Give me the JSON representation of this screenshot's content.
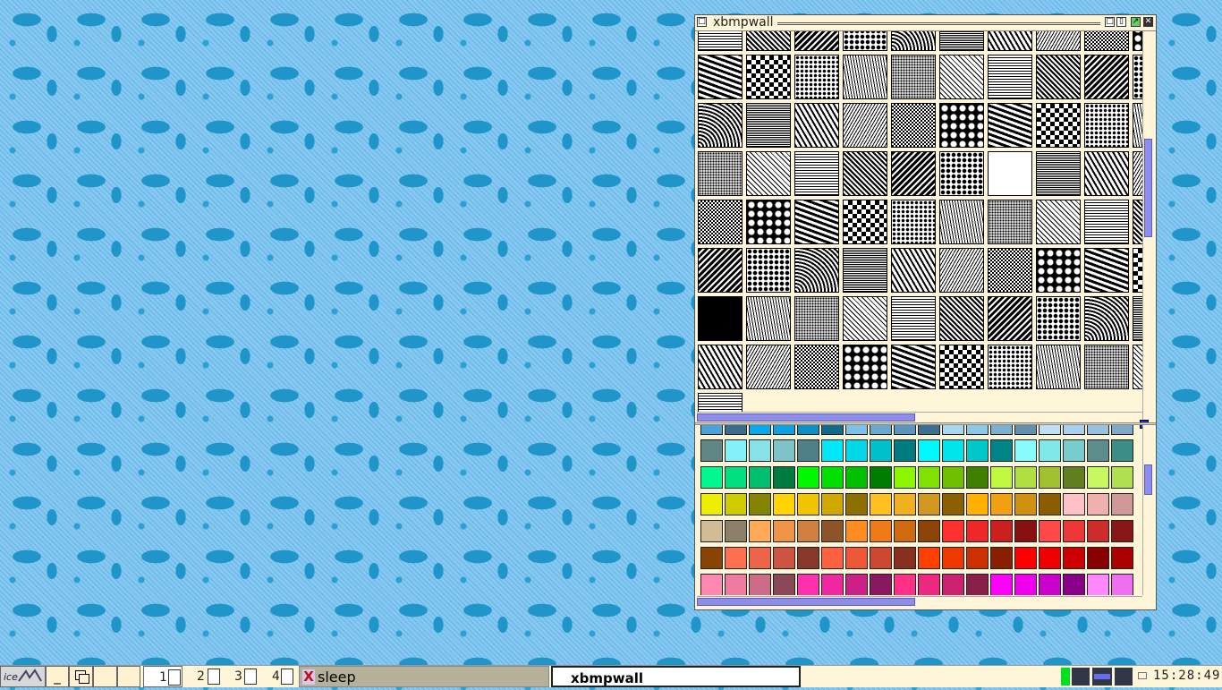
{
  "window": {
    "title": "xbmpwall",
    "title_icon": "window-menu-icon",
    "controls": [
      "minimize-icon",
      "maximize-icon",
      "shade-icon",
      "close-icon"
    ]
  },
  "patterns": [
    "check-small",
    "dark-diag",
    "swirl",
    "square-dots",
    "arc",
    "wave-text",
    "zigzag",
    "wave-dense",
    "checker-fine",
    "bumps",
    "waves",
    "weave",
    "floral",
    "wood-grain",
    "dots-fine",
    "diamond-lattice",
    "chevron-tile",
    "brick",
    "brick-dark",
    "diag-dots",
    "quilt",
    "crosshatch-fine",
    "grid-fine",
    "grid-med",
    "grid-dense",
    "grid-light",
    "diag-fine",
    "noise-dark",
    "dots-dense",
    "fine-mesh",
    "noise-mid",
    "noise-dense",
    "grid-dense2",
    "dark-mesh",
    "dark-mesh2",
    "dark-dots",
    "white",
    "sparse-dots",
    "dots-light",
    "dots-lighter",
    "dots-light2",
    "med-dots",
    "med-dots2",
    "lines-light",
    "lines-light2",
    "gray-dots",
    "gray-dots2",
    "gray-med",
    "gray-med2",
    "gray-dark",
    "gray-dark2",
    "gray-darker",
    "gray-darker2",
    "gray-darkest",
    "grid-light-sq",
    "hlines",
    "hlines-dense",
    "hlines-thick",
    "hlines-vdense",
    "grid-dark",
    "black",
    "black-grid",
    "hlines-dark",
    "diag-left",
    "diag-right-dense",
    "diag-right",
    "diag-right-thin",
    "diag-thick",
    "diag-thick2",
    "diag-thick3",
    "crosshatch",
    "diamond-dark",
    "vlines",
    "vlines-thick",
    "swirl2",
    "vlines-thin",
    "checker",
    "houndstooth",
    "plaid",
    "checker2",
    "ink-drops"
  ],
  "swatches": [
    [
      "#4aa2d8",
      "#3c6c8c",
      "#0aa8e8",
      "#0fa0e0",
      "#0d8fc4",
      "#126a8a",
      "#7ec0e8",
      "#6aa8d0",
      "#5a94c0",
      "#3e6f90",
      "#a8d8f0",
      "#8ec8e8",
      "#7ab0d0",
      "#6490b0",
      "#bfe0f4",
      "#aad0ec",
      "#98c0e0",
      "#80a8c8"
    ],
    [
      "#5f8585",
      "#84f0f8",
      "#88e0e8",
      "#7cc4c8",
      "#4f8088",
      "#00e8f8",
      "#00d8e8",
      "#00c0cc",
      "#007c80",
      "#00f8ff",
      "#00e4ec",
      "#00c8c8",
      "#008488",
      "#88fcfc",
      "#80e8e8",
      "#78cccc",
      "#5c8c8c",
      "#3c8c88"
    ],
    [
      "#00f890",
      "#00e080",
      "#00c070",
      "#007c40",
      "#00f800",
      "#00e000",
      "#00c000",
      "#007c00",
      "#8cf800",
      "#80e000",
      "#70c000",
      "#408000",
      "#c0f840",
      "#b0e040",
      "#a0c030",
      "#608020",
      "#c8f860",
      "#b0e050"
    ],
    [
      "#eeee00",
      "#cccc00",
      "#848400",
      "#ffd400",
      "#f0c400",
      "#d0a800",
      "#8c7000",
      "#ffc020",
      "#f0b020",
      "#d09820",
      "#8c6000",
      "#ffb000",
      "#f0a010",
      "#d09010",
      "#8c5c00",
      "#ffc0c8",
      "#f0b0b0",
      "#d09898"
    ],
    [
      "#d2bc96",
      "#8c8068",
      "#ffaa58",
      "#f09448",
      "#d08040",
      "#8c5428",
      "#ff8c20",
      "#f07a18",
      "#d06a10",
      "#8c4408",
      "#ff3030",
      "#ee2828",
      "#cc2020",
      "#881010",
      "#ff4848",
      "#ee3838",
      "#cc2c2c",
      "#881818"
    ],
    [
      "#884400",
      "#ff7050",
      "#ee6448",
      "#cc5440",
      "#883828",
      "#ff6040",
      "#ee5838",
      "#cc4830",
      "#883020",
      "#ff4000",
      "#ee3800",
      "#cc3000",
      "#882000",
      "#ff0000",
      "#ee0000",
      "#cc0000",
      "#880000",
      "#aa0000"
    ],
    [
      "#ff88b0",
      "#ee7ca0",
      "#cc6c88",
      "#884858",
      "#ff30b0",
      "#ee28a0",
      "#cc2088",
      "#881860",
      "#ff3088",
      "#ee2880",
      "#cc2070",
      "#882048",
      "#ff00ff",
      "#ee00ee",
      "#cc00cc",
      "#880088",
      "#ff88ff",
      "#ee70ee"
    ]
  ],
  "taskbar": {
    "start_icon": "icewm-logo-icon",
    "buttons": [
      "show-desktop-icon",
      "window-list-icon",
      "blank-button",
      "blank-button"
    ],
    "workspaces": [
      "1",
      "2",
      "3",
      "4"
    ],
    "tasks": [
      {
        "label": "sleep",
        "icon": "tk-app-icon",
        "active": false
      },
      {
        "label": "xbmpwall",
        "icon": "",
        "active": true
      }
    ],
    "tray_icons": [
      "cpu-monitor-icon",
      "net-monitor-icon",
      "mem-monitor-icon",
      "net-monitor-icon2",
      "mail-icon"
    ],
    "clock": "15:28:49"
  },
  "colors": {
    "desktop_bg": "#87c8f2",
    "desktop_pattern": "#1f95c9",
    "window_bg": "#fff5d8",
    "scroll_thumb": "#8e8ee8",
    "taskbar_bg": "#fff5d8"
  }
}
